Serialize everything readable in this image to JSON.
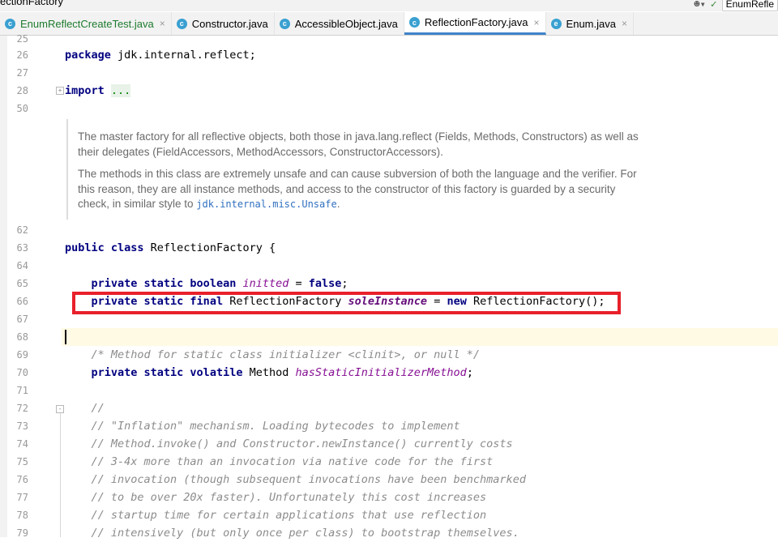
{
  "window": {
    "title": "ectionFactory",
    "run_config": "EnumRefle"
  },
  "tabs": [
    {
      "label": "EnumReflectCreateTest.java",
      "icon": "class-icon",
      "active": false
    },
    {
      "label": "Constructor.java",
      "icon": "class-icon",
      "active": false
    },
    {
      "label": "AccessibleObject.java",
      "icon": "class-icon",
      "active": false
    },
    {
      "label": "ReflectionFactory.java",
      "icon": "class-icon",
      "active": true
    },
    {
      "label": "Enum.java",
      "icon": "enum-icon",
      "active": false
    }
  ],
  "close_glyph": "×",
  "line_numbers": [
    "25",
    "26",
    "27",
    "28",
    "50",
    "62",
    "63",
    "64",
    "65",
    "66",
    "67",
    "68",
    "69",
    "70",
    "71",
    "72",
    "73",
    "74",
    "75",
    "76",
    "77",
    "78",
    "79"
  ],
  "code": {
    "pkg_kw": "package",
    "pkg_name": " jdk.internal.reflect;",
    "import_kw": "import",
    "import_fold": "...",
    "cls_mod": "public class",
    "cls_name": " ReflectionFactory {",
    "l65_kw": "private static boolean",
    "l65_field": "initted",
    "l65_mid": " = ",
    "l65_val": "false",
    "l65_end": ";",
    "l66_kw": "private static final",
    "l66_type": " ReflectionFactory ",
    "l66_field": "soleInstance",
    "l66_mid": " = ",
    "l66_new": "new",
    "l66_end": " ReflectionFactory();",
    "l69": "/* Method for static class initializer <clinit>, or null */",
    "l70_kw": "private static volatile",
    "l70_type": " Method ",
    "l70_field": "hasStaticInitializerMethod",
    "l70_end": ";",
    "l72": "//",
    "l73": "// \"Inflation\" mechanism. Loading bytecodes to implement",
    "l74": "// Method.invoke() and Constructor.newInstance() currently costs",
    "l75": "// 3-4x more than an invocation via native code for the first",
    "l76": "// invocation (though subsequent invocations have been benchmarked",
    "l77": "// to be over 20x faster). Unfortunately this cost increases",
    "l78": "// startup time for certain applications that use reflection",
    "l79": "// intensively (but only once per class) to bootstrap themselves."
  },
  "javadoc": {
    "p1": "The master factory for all reflective objects, both those in java.lang.reflect (Fields, Methods, Constructors) as well as their delegates (FieldAccessors, MethodAccessors, ConstructorAccessors).",
    "p2": "The methods in this class are extremely unsafe and can cause subversion of both the language and the verifier. For this reason, they are all instance methods, and access to the constructor of this factory is guarded by a security check, in similar style to ",
    "p2_link": "jdk.internal.misc.Unsafe",
    "p2_end": "."
  },
  "colors": {
    "highlight_box": "#e8202a",
    "keyword": "#000080",
    "field": "#871094",
    "comment": "#8c8c8c",
    "current_line": "#fffae3"
  }
}
